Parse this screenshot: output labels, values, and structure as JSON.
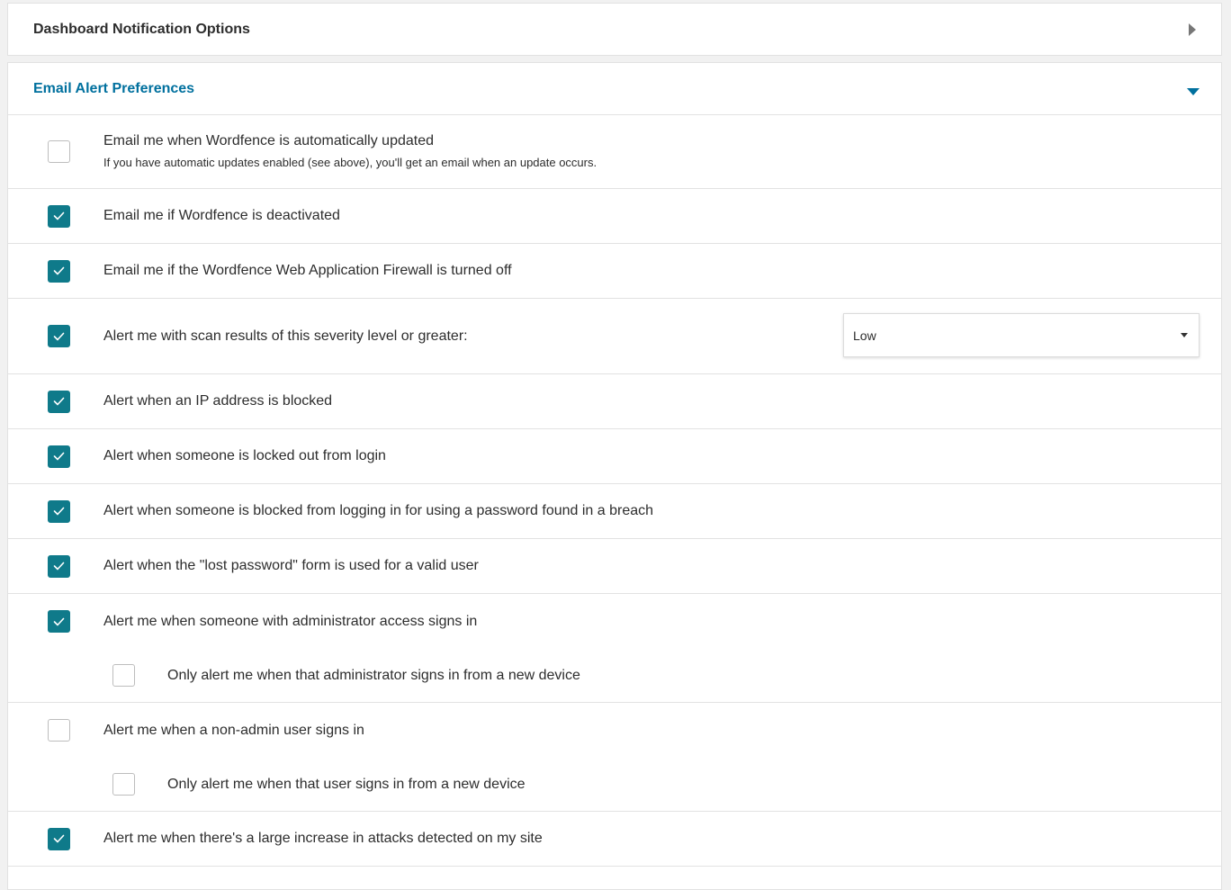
{
  "colors": {
    "accent": "#0f7a8a",
    "header_active": "#00709e",
    "border": "#e2e2e2",
    "background": "#f1f1f1"
  },
  "dashboard_panel": {
    "title": "Dashboard Notification Options",
    "icon": "caret-right-icon"
  },
  "email_panel": {
    "title": "Email Alert Preferences",
    "icon": "caret-down-icon",
    "options": [
      {
        "label": "Email me when Wordfence is automatically updated",
        "sublabel": "If you have automatic updates enabled (see above), you'll get an email when an update occurs.",
        "checked": false
      },
      {
        "label": "Email me if Wordfence is deactivated",
        "checked": true
      },
      {
        "label": "Email me if the Wordfence Web Application Firewall is turned off",
        "checked": true
      },
      {
        "label": "Alert me with scan results of this severity level or greater:",
        "checked": true
      },
      {
        "label": "Alert when an IP address is blocked",
        "checked": true
      },
      {
        "label": "Alert when someone is locked out from login",
        "checked": true
      },
      {
        "label": "Alert when someone is blocked from logging in for using a password found in a breach",
        "checked": true
      },
      {
        "label": "Alert when the \"lost password\" form is used for a valid user",
        "checked": true
      },
      {
        "label": "Alert me when someone with administrator access signs in",
        "checked": true
      },
      {
        "label": "Only alert me when that administrator signs in from a new device",
        "checked": false
      },
      {
        "label": "Alert me when a non-admin user signs in",
        "checked": false
      },
      {
        "label": "Only alert me when that user signs in from a new device",
        "checked": false
      },
      {
        "label": "Alert me when there's a large increase in attacks detected on my site",
        "checked": true
      }
    ],
    "severity_select": {
      "value": "Low"
    }
  }
}
